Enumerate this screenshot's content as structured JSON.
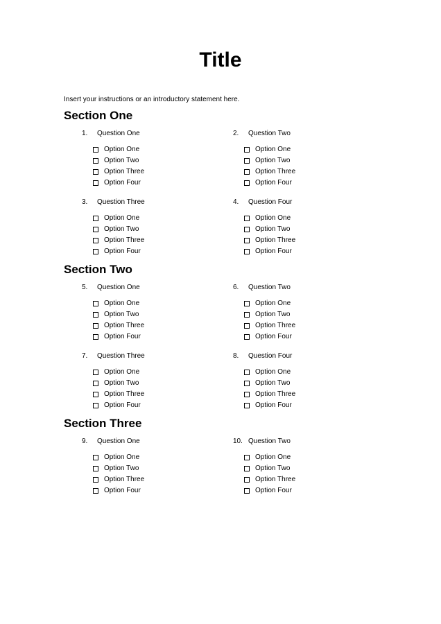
{
  "title": "Title",
  "instructions": "Insert your instructions or an introductory statement here.",
  "sections": [
    {
      "heading": "Section One",
      "questions": [
        {
          "number": "1.",
          "label": "Question One",
          "options": [
            "Option One",
            "Option Two",
            "Option Three",
            "Option Four"
          ]
        },
        {
          "number": "2.",
          "label": "Question Two",
          "options": [
            "Option One",
            "Option Two",
            "Option Three",
            "Option Four"
          ]
        },
        {
          "number": "3.",
          "label": "Question Three",
          "options": [
            "Option One",
            "Option Two",
            "Option Three",
            "Option Four"
          ]
        },
        {
          "number": "4.",
          "label": "Question Four",
          "options": [
            "Option One",
            "Option Two",
            "Option Three",
            "Option Four"
          ]
        }
      ]
    },
    {
      "heading": "Section Two",
      "questions": [
        {
          "number": "5.",
          "label": "Question One",
          "options": [
            "Option One",
            "Option Two",
            "Option Three",
            "Option Four"
          ]
        },
        {
          "number": "6.",
          "label": "Question Two",
          "options": [
            "Option One",
            "Option Two",
            "Option Three",
            "Option Four"
          ]
        },
        {
          "number": "7.",
          "label": "Question Three",
          "options": [
            "Option One",
            "Option Two",
            "Option Three",
            "Option Four"
          ]
        },
        {
          "number": "8.",
          "label": "Question Four",
          "options": [
            "Option One",
            "Option Two",
            "Option Three",
            "Option Four"
          ]
        }
      ]
    },
    {
      "heading": "Section Three",
      "questions": [
        {
          "number": "9.",
          "label": "Question One",
          "options": [
            "Option One",
            "Option Two",
            "Option Three",
            "Option Four"
          ]
        },
        {
          "number": "10.",
          "label": "Question Two",
          "options": [
            "Option One",
            "Option Two",
            "Option Three",
            "Option Four"
          ]
        }
      ]
    }
  ]
}
